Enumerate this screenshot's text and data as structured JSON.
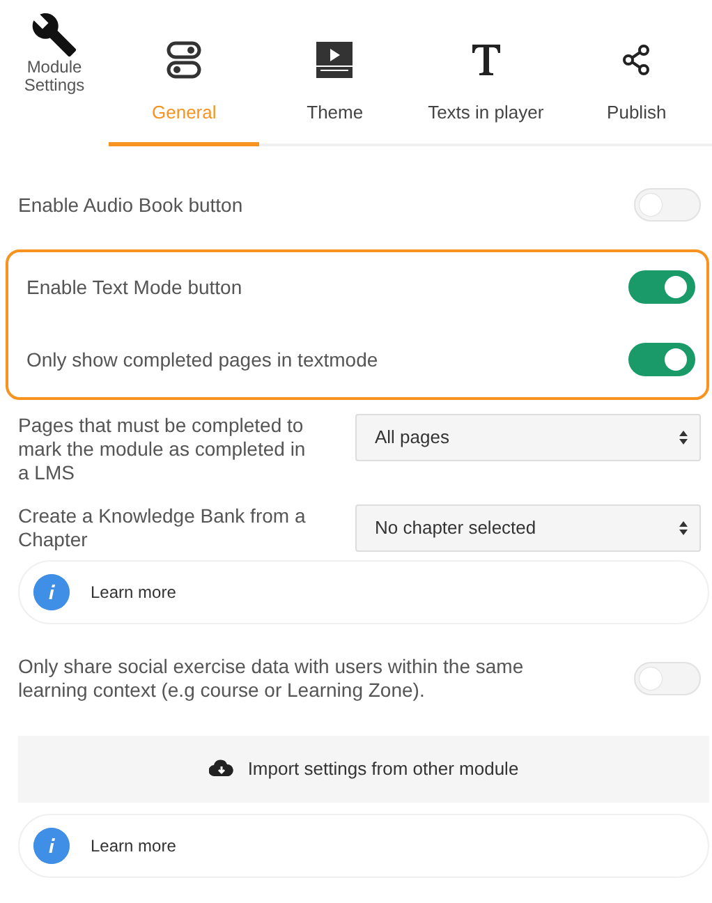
{
  "header": {
    "title": "Module Settings"
  },
  "tabs": [
    {
      "label": "General",
      "kind": "toggles",
      "selected": true
    },
    {
      "label": "Theme",
      "kind": "player",
      "selected": false
    },
    {
      "label": "Texts in player",
      "kind": "text",
      "selected": false
    },
    {
      "label": "Publish",
      "kind": "share",
      "selected": false
    }
  ],
  "settings": [
    {
      "kind": "toggle",
      "label": "Enable Audio Book button",
      "on": false
    },
    {
      "kind": "group",
      "items": [
        {
          "kind": "toggle",
          "label": "Enable Text Mode button",
          "on": true
        },
        {
          "kind": "toggle",
          "label": "Only show completed pages in textmode",
          "on": true
        }
      ]
    },
    {
      "kind": "select",
      "label": "Pages that must be completed to mark the module as completed in a LMS",
      "value": "All pages"
    },
    {
      "kind": "select",
      "label": "Create a Knowledge Bank from a Chapter",
      "value": "No chapter selected"
    },
    {
      "kind": "info",
      "label": "Learn more"
    },
    {
      "kind": "toggle",
      "label": "Only share social exercise data with users within the same learning context (e.g course or Learning Zone).",
      "on": false
    },
    {
      "kind": "button",
      "label": "Import settings from other module"
    },
    {
      "kind": "info",
      "label": "Learn more"
    }
  ]
}
